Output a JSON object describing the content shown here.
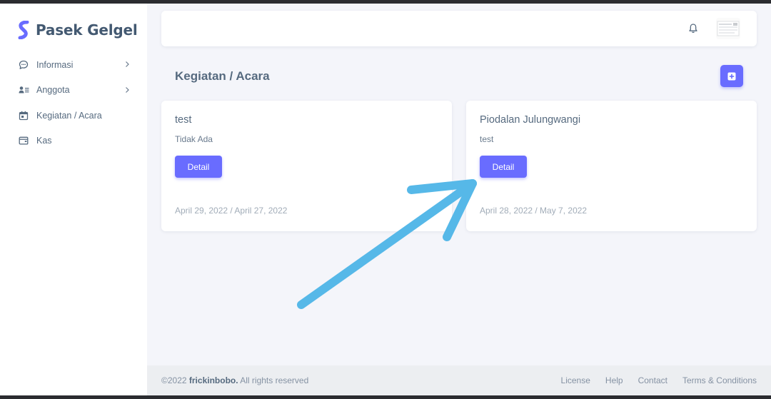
{
  "colors": {
    "primary": "#696cff",
    "arrow": "#56b8e8",
    "sidebar_bg": "#ffffff",
    "page_bg": "#f4f5fa"
  },
  "brand": {
    "name": "Pasek Gelgel",
    "logo_icon": "s-logo-icon"
  },
  "sidebar": {
    "items": [
      {
        "label": "Informasi",
        "icon": "chat-icon",
        "has_submenu": true
      },
      {
        "label": "Anggota",
        "icon": "user-list-icon",
        "has_submenu": true
      },
      {
        "label": "Kegiatan / Acara",
        "icon": "calendar-icon",
        "has_submenu": false
      },
      {
        "label": "Kas",
        "icon": "wallet-icon",
        "has_submenu": false
      }
    ]
  },
  "navbar": {
    "notification_icon": "bell-icon",
    "avatar_icon": "avatar-image"
  },
  "page": {
    "title": "Kegiatan / Acara",
    "add_icon": "plus-square-icon"
  },
  "events": [
    {
      "title": "test",
      "description": "Tidak Ada",
      "button_label": "Detail",
      "dates": "April 29, 2022 / April 27, 2022"
    },
    {
      "title": "Piodalan Julungwangi",
      "description": "test",
      "button_label": "Detail",
      "dates": "April 28, 2022 / May 7, 2022"
    }
  ],
  "footer": {
    "copyright_prefix": "©2022",
    "author": "frickinbobo.",
    "copyright_suffix": "All rights reserved",
    "links": [
      "License",
      "Help",
      "Contact",
      "Terms & Conditions"
    ]
  }
}
